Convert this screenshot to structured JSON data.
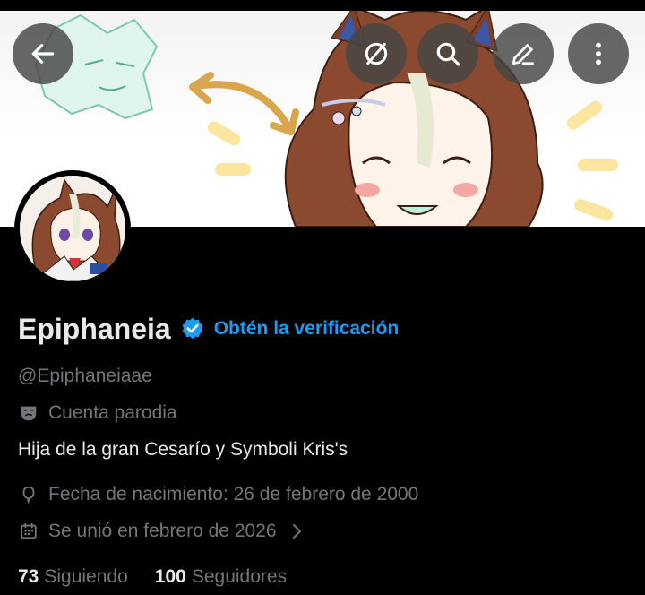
{
  "header": {
    "back_icon": "arrow-left-icon",
    "buttons": [
      "grok-icon",
      "search-icon",
      "edit-icon",
      "more-vertical-icon"
    ]
  },
  "profile": {
    "name": "Epiphaneia",
    "verify_link": "Obtén la verificación",
    "handle": "@Epiphaneiaae",
    "parody_label": "Cuenta parodia",
    "bio": "Hija de la gran Cesarío y Symboli Kris's",
    "birthday": "Fecha de nacimiento: 26 de febrero de 2000",
    "joined": "Se unió en febrero de 2026",
    "following_count": "73",
    "following_label": "Siguiendo",
    "followers_count": "100",
    "followers_label": "Seguidores"
  },
  "colors": {
    "accent": "#1d9bf0",
    "muted": "#71767b",
    "text": "#e7e9ea",
    "background": "#000000"
  }
}
